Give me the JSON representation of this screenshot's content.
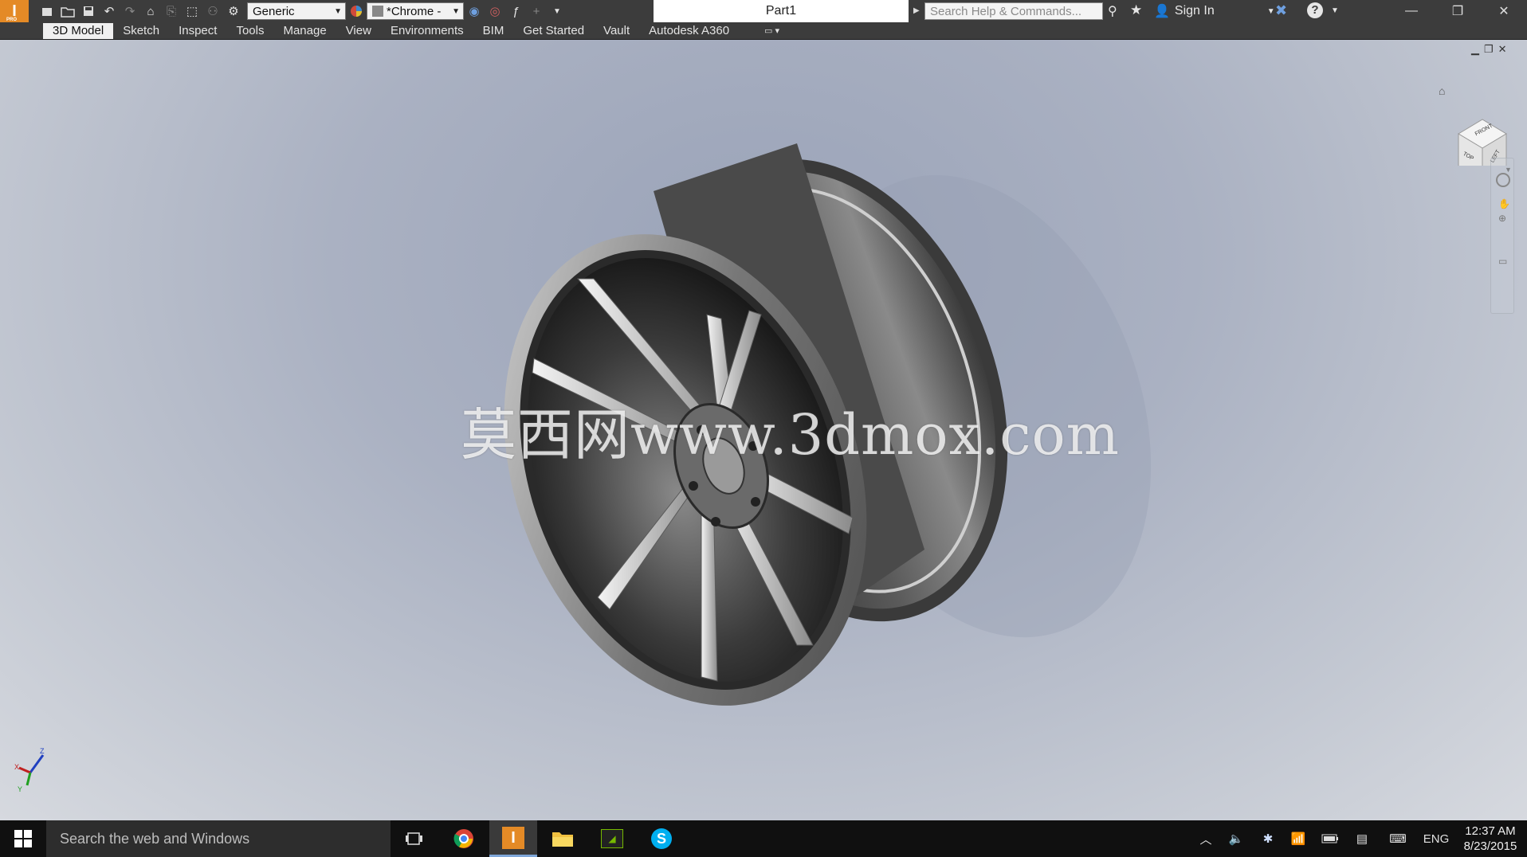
{
  "app": {
    "title": "Part1",
    "appearance_select": "Generic",
    "material_select": "*Chrome -",
    "search_placeholder": "Search Help & Commands...",
    "sign_in_label": "Sign In"
  },
  "ribbon": {
    "tabs": [
      "3D Model",
      "Sketch",
      "Inspect",
      "Tools",
      "Manage",
      "View",
      "Environments",
      "BIM",
      "Get Started",
      "Vault",
      "Autodesk A360"
    ],
    "active_tab": "3D Model"
  },
  "viewport": {
    "watermark": "莫西网www.3dmox.com",
    "viewcube_faces": [
      "FRONT",
      "TOP",
      "LEFT"
    ],
    "axis_labels": [
      "X",
      "Y",
      "Z"
    ],
    "wheel_color": "#6b6b6b"
  },
  "taskbar": {
    "search_placeholder": "Search the web and Windows",
    "language": "ENG",
    "time": "12:37 AM",
    "date": "8/23/2015"
  },
  "colors": {
    "titlebar_bg": "#3c3c3c",
    "taskbar_bg": "#101010",
    "accent": "#7fa7d9",
    "inventor_orange": "#e48a26"
  }
}
